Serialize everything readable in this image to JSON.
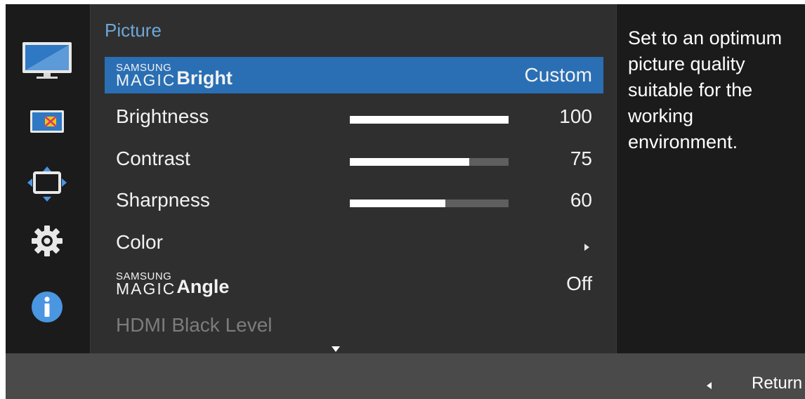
{
  "menu": {
    "title": "Picture",
    "items": [
      {
        "brand_small": "SAMSUNG",
        "brand_large": "MAGIC",
        "label": "Bright",
        "value": "Custom",
        "selected": true
      },
      {
        "label": "Brightness",
        "value": "100",
        "level": 100
      },
      {
        "label": "Contrast",
        "value": "75",
        "level": 75
      },
      {
        "label": "Sharpness",
        "value": "60",
        "level": 60
      },
      {
        "label": "Color",
        "submenu_icon": "arrow-right-icon"
      },
      {
        "brand_small": "SAMSUNG",
        "brand_large": "MAGIC",
        "label": "Angle",
        "value": "Off"
      },
      {
        "label": "HDMI Black Level",
        "disabled": true
      }
    ],
    "scroll_icon": "arrow-down-icon"
  },
  "rail": {
    "icons": [
      "picture-monitor-icon",
      "onscreen-display-icon",
      "position-size-icon",
      "settings-gear-icon",
      "information-icon"
    ]
  },
  "help": {
    "text": "Set to an optimum picture quality suitable for the working environment."
  },
  "footer": {
    "return_label": "Return",
    "return_icon": "arrow-left-icon"
  },
  "colors": {
    "accent": "#2a6fb4",
    "title": "#6ea7d8",
    "panel": "#2f2f2f",
    "background": "#1b1b1b",
    "footer": "#4a4a4a"
  }
}
